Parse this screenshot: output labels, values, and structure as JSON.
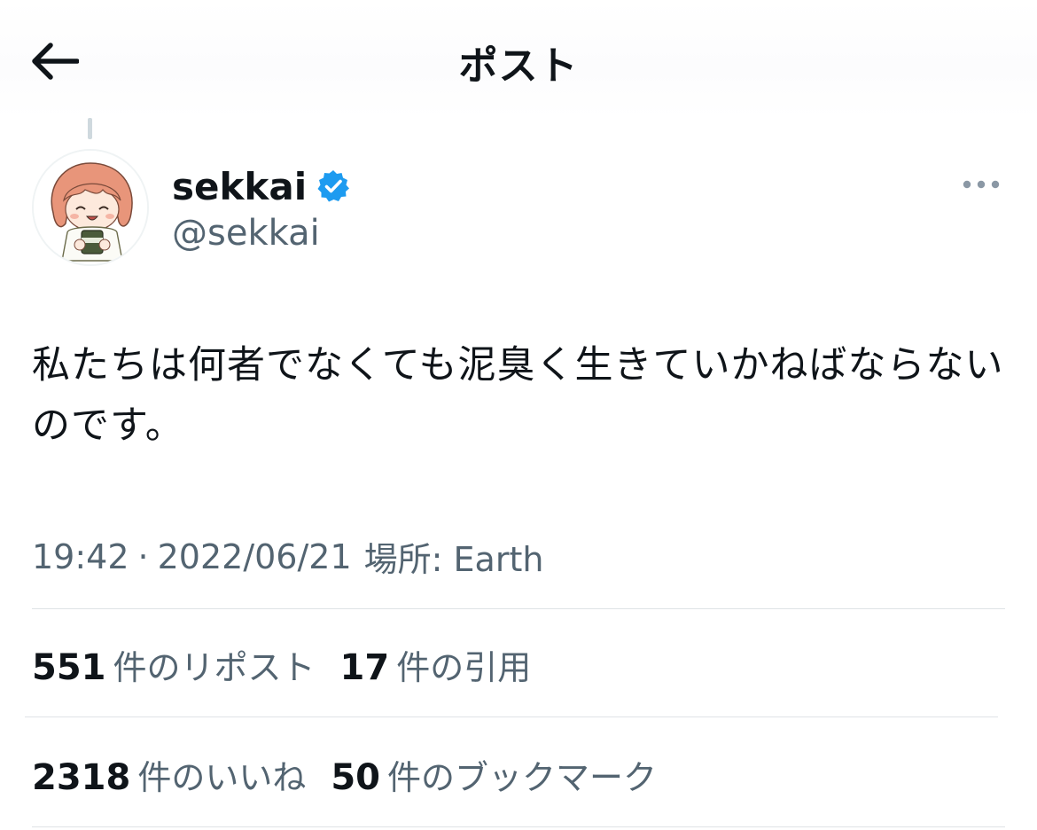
{
  "header": {
    "title": "ポスト",
    "back_icon": "arrow-left-icon"
  },
  "post": {
    "author": {
      "display_name": "sekkai",
      "handle": "@sekkai",
      "verified": true,
      "verified_color": "#1d9bf0"
    },
    "text": "私たちは何者でなくても泥臭く生きていかねばならないのです。",
    "time": "19:42",
    "separator": "·",
    "date": "2022/06/21",
    "location": "場所: Earth"
  },
  "stats": {
    "reposts": {
      "count": "551",
      "label": "件のリポスト"
    },
    "quotes": {
      "count": "17",
      "label": "件の引用"
    },
    "likes": {
      "count": "2318",
      "label": "件のいいね"
    },
    "bookmarks": {
      "count": "50",
      "label": "件のブックマーク"
    }
  },
  "colors": {
    "text_primary": "#0f1419",
    "text_secondary": "#536471",
    "divider": "#dfe3e6",
    "accent": "#1d9bf0"
  }
}
